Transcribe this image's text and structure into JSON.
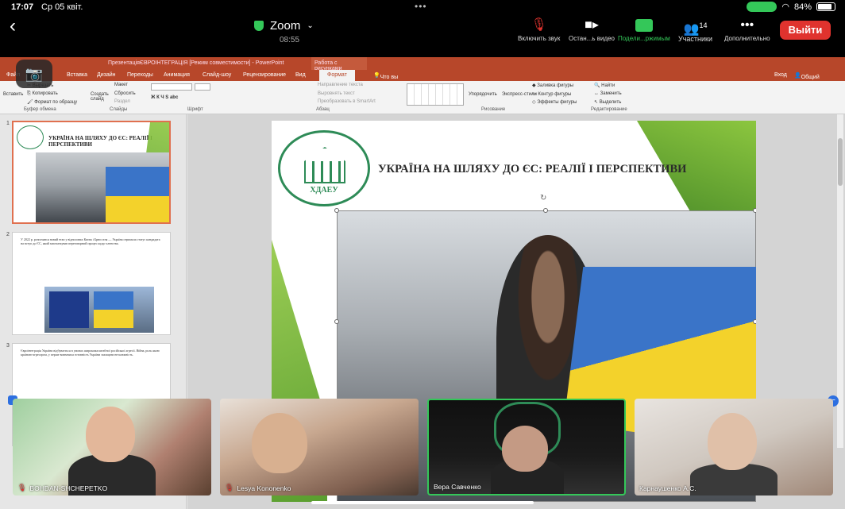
{
  "status_bar": {
    "time": "17:07",
    "date": "Ср 05 квіт.",
    "battery": "84%"
  },
  "zoom": {
    "title": "Zoom",
    "timer": "08:55",
    "controls": {
      "unmute": "Включить звук",
      "stop_video": "Остан...ь видео",
      "share": "Подели...ржимым",
      "participants": "Участники",
      "participants_count": "14",
      "more": "Дополнительно"
    },
    "leave_label": "Выйти"
  },
  "powerpoint": {
    "window_title": "ПрезентаціяЄВРОІНТЕГРАЦІЯ [Режим совместимости] - PowerPoint",
    "context_tab_group": "Работа с рисунками",
    "tabs": [
      "Файл",
      "Вставка",
      "Дизайн",
      "Переходы",
      "Анимация",
      "Слайд-шоу",
      "Рецензирование",
      "Вид",
      "Формат"
    ],
    "active_tab": "Формат",
    "search_placeholder": "Что вы хотите сделать?",
    "login": "Вход",
    "share": "Общий доступ",
    "ribbon": {
      "clipboard": {
        "paste": "Вставить",
        "cut": "Вырезать",
        "copy": "Копировать",
        "format_painter": "Формат по образцу",
        "label": "Буфер обмена"
      },
      "slides": {
        "new_slide": "Создать слайд",
        "layout": "Макет",
        "reset": "Сбросить",
        "section": "Раздел",
        "label": "Слайды"
      },
      "font_label": "Шрифт",
      "paragraph": {
        "text_direction": "Направление текста",
        "align_text": "Выровнять текст",
        "smartart": "Преобразовать в SmartArt",
        "label": "Абзац"
      },
      "drawing": {
        "arrange": "Упорядочить",
        "quick_styles": "Экспресс-стили",
        "fill": "Заливка фигуры",
        "outline": "Контур фигуры",
        "effects": "Эффекты фигуры",
        "label": "Рисование"
      },
      "editing": {
        "find": "Найти",
        "replace": "Заменить",
        "select": "Выделить",
        "label": "Редактирование"
      }
    },
    "thumbnails": [
      {
        "num": "1",
        "title": "УКРАЇНА НА ШЛЯХУ ДО ЄС: РЕАЛІЇ І ПЕРСПЕКТИВИ"
      },
      {
        "num": "2",
        "text": "У 2022 р. розпочався новий етап у відносинах Києва і Брюсселя — Україна отримала статус кандидата на вступ до ЄС, який започаткував переговорний процес щодо членства."
      },
      {
        "num": "3",
        "text": "Євроінтеграція України відбувається в умовах широкомасштабної російської агресії. Війна, роль якою країною-агресором, у перше визначила готовність України захищати незалежність."
      }
    ],
    "slide": {
      "logo_abbr": "ХДАЕУ",
      "title": "УКРАЇНА НА ШЛЯХУ ДО ЄС: РЕАЛІЇ І ПЕРСПЕКТИВИ"
    }
  },
  "participants": [
    {
      "name": "BOHDAN-SHCHEPETKO",
      "muted": true
    },
    {
      "name": "Lesya Kononenko",
      "muted": true
    },
    {
      "name": "Вера Савченко",
      "muted": false,
      "active": true
    },
    {
      "name": "Карнаушенко А.С.",
      "muted": false
    }
  ],
  "colors": {
    "ppt_accent": "#b7472a",
    "zoom_green": "#34c759",
    "leave_red": "#e0332e",
    "slide_green": "#8cc63f"
  }
}
